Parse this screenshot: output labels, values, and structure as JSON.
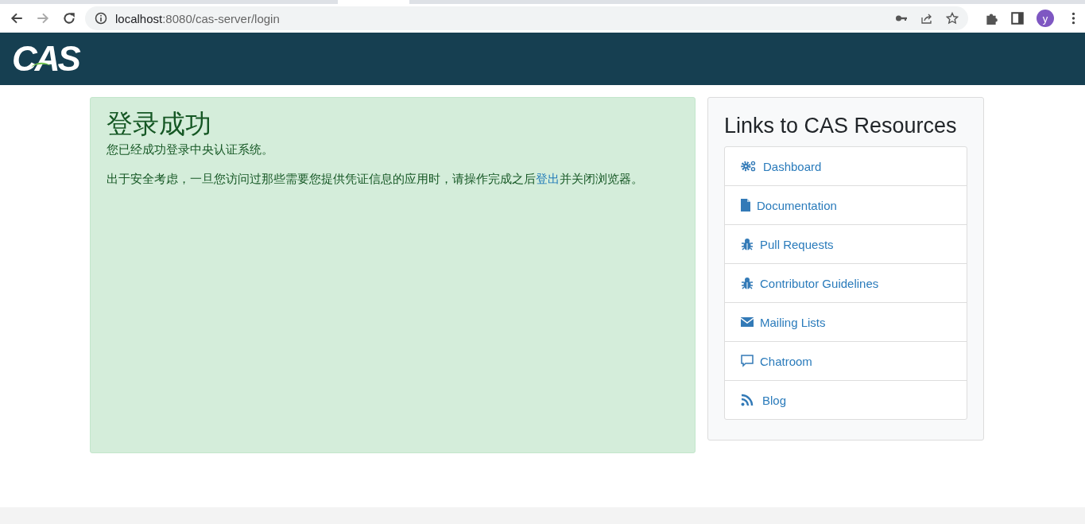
{
  "browser": {
    "url_host": "localhost",
    "url_rest": ":8080/cas-server/login",
    "forward_disabled": true,
    "avatar": "y"
  },
  "header": {
    "logo": "CAS"
  },
  "notice": {
    "title": "登录成功",
    "message": "您已经成功登录中央认证系统。",
    "warning_before": "出于安全考虑，一旦您访问过那些需要您提供凭证信息的应用时，请操作完成之后",
    "warning_link": "登出",
    "warning_after": "并关闭浏览器。"
  },
  "resources": {
    "title": "Links to CAS Resources",
    "links": [
      {
        "label": "Dashboard",
        "kind": "gears"
      },
      {
        "label": "Documentation",
        "kind": "file"
      },
      {
        "label": "Pull Requests",
        "kind": "bug"
      },
      {
        "label": "Contributor Guidelines",
        "kind": "bug"
      },
      {
        "label": "Mailing Lists",
        "kind": "envelope"
      },
      {
        "label": "Chatroom",
        "kind": "chat"
      },
      {
        "label": "Blog",
        "kind": "rss"
      }
    ]
  }
}
